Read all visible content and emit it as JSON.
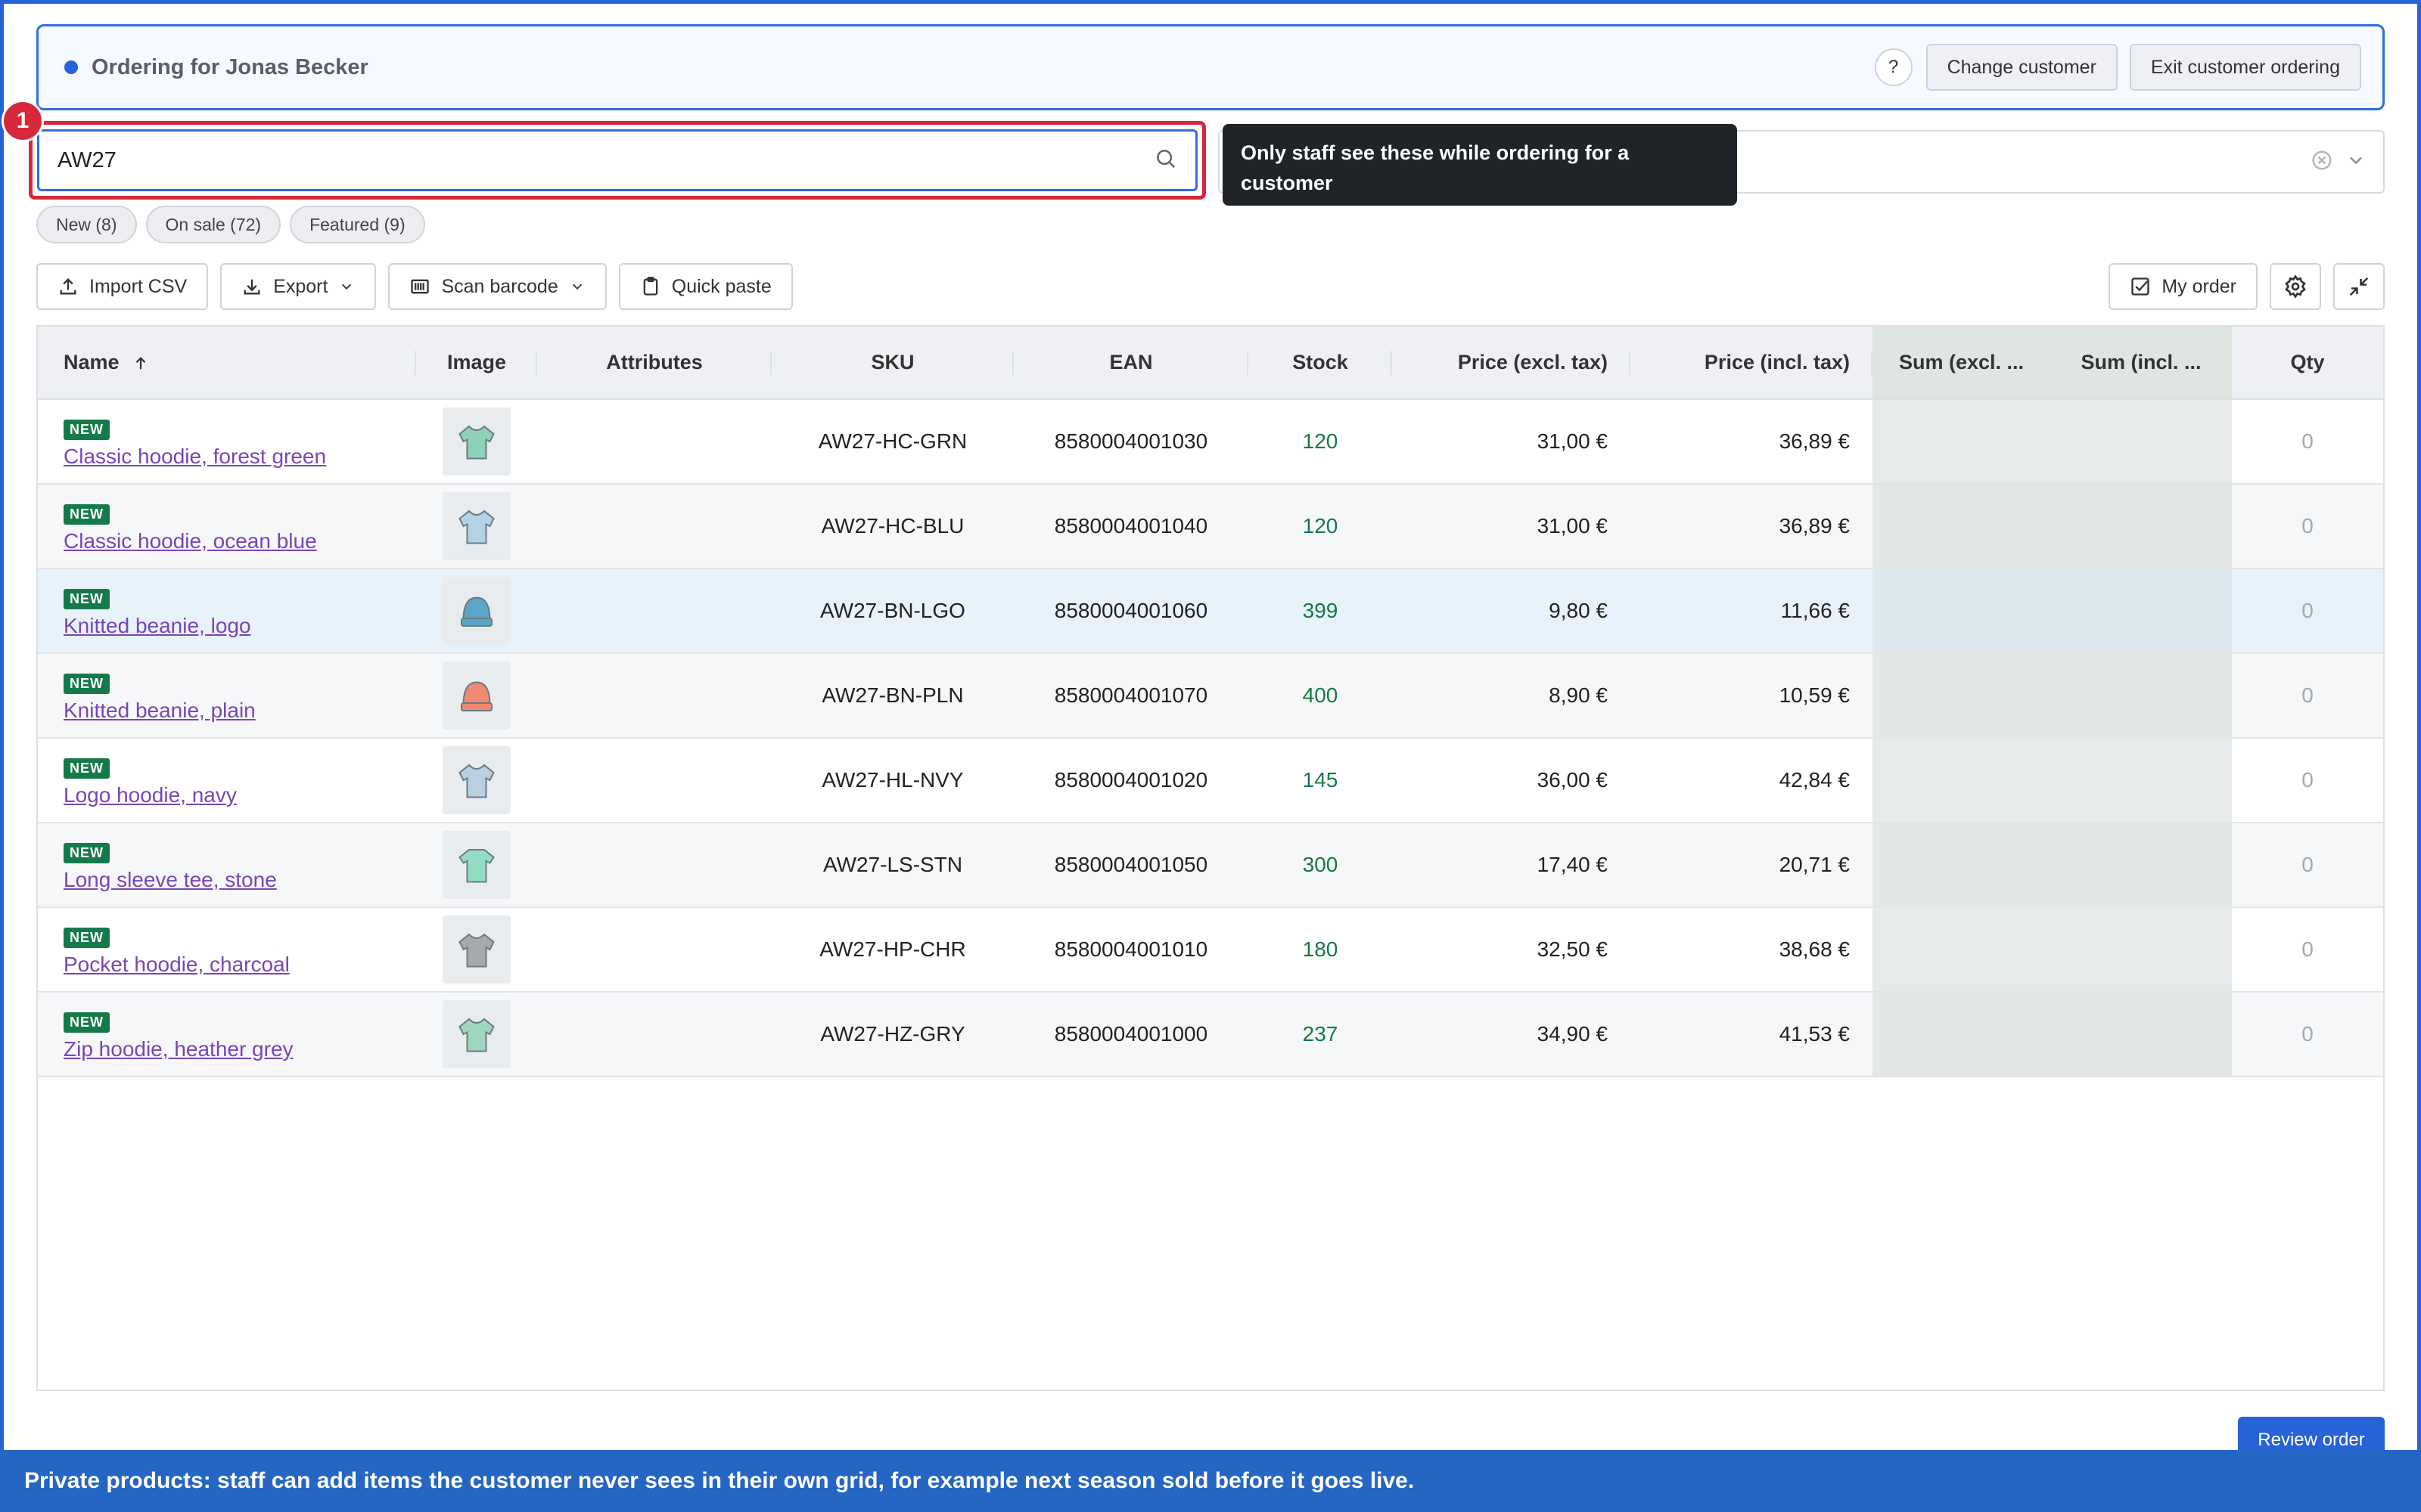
{
  "banner": {
    "title": "Ordering for Jonas Becker",
    "help_label": "?",
    "change_customer": "Change customer",
    "exit_ordering": "Exit customer ordering"
  },
  "search": {
    "value": "AW27",
    "step_number": "1"
  },
  "tooltip": {
    "text": "Only staff see these while ordering for a customer"
  },
  "chips": [
    "New (8)",
    "On sale (72)",
    "Featured (9)"
  ],
  "toolbar": {
    "import_csv": "Import CSV",
    "export": "Export",
    "scan_barcode": "Scan barcode",
    "quick_paste": "Quick paste",
    "my_order": "My order"
  },
  "table": {
    "columns": [
      "Name",
      "Image",
      "Attributes",
      "SKU",
      "EAN",
      "Stock",
      "Price (excl. tax)",
      "Price (incl. tax)",
      "Sum (excl. ...",
      "Sum (incl. ...",
      "Qty"
    ],
    "new_tag": "NEW",
    "rows": [
      {
        "name": "Classic hoodie, forest green",
        "sku": "AW27-HC-GRN",
        "ean": "8580004001030",
        "stock": "120",
        "price_ex": "31,00 €",
        "price_in": "36,89 €",
        "qty": "0",
        "thumb_color": "#8fd1b8",
        "thumb_icon": "hoodie-icon"
      },
      {
        "name": "Classic hoodie, ocean blue",
        "sku": "AW27-HC-BLU",
        "ean": "8580004001040",
        "stock": "120",
        "price_ex": "31,00 €",
        "price_in": "36,89 €",
        "qty": "0",
        "thumb_color": "#b4d2e6",
        "thumb_icon": "hoodie-icon"
      },
      {
        "name": "Knitted beanie, logo",
        "sku": "AW27-BN-LGO",
        "ean": "8580004001060",
        "stock": "399",
        "price_ex": "9,80 €",
        "price_in": "11,66 €",
        "qty": "0",
        "thumb_color": "#5aa6c8",
        "thumb_icon": "beanie-icon"
      },
      {
        "name": "Knitted beanie, plain",
        "sku": "AW27-BN-PLN",
        "ean": "8580004001070",
        "stock": "400",
        "price_ex": "8,90 €",
        "price_in": "10,59 €",
        "qty": "0",
        "thumb_color": "#ee8a72",
        "thumb_icon": "beanie-icon"
      },
      {
        "name": "Logo hoodie, navy",
        "sku": "AW27-HL-NVY",
        "ean": "8580004001020",
        "stock": "145",
        "price_ex": "36,00 €",
        "price_in": "42,84 €",
        "qty": "0",
        "thumb_color": "#b9cfe2",
        "thumb_icon": "hoodie-icon"
      },
      {
        "name": "Long sleeve tee, stone",
        "sku": "AW27-LS-STN",
        "ean": "8580004001050",
        "stock": "300",
        "price_ex": "17,40 €",
        "price_in": "20,71 €",
        "qty": "0",
        "thumb_color": "#92dcc4",
        "thumb_icon": "tee-icon"
      },
      {
        "name": "Pocket hoodie, charcoal",
        "sku": "AW27-HP-CHR",
        "ean": "8580004001010",
        "stock": "180",
        "price_ex": "32,50 €",
        "price_in": "38,68 €",
        "qty": "0",
        "thumb_color": "#a7a9ab",
        "thumb_icon": "hoodie-icon"
      },
      {
        "name": "Zip hoodie, heather grey",
        "sku": "AW27-HZ-GRY",
        "ean": "8580004001000",
        "stock": "237",
        "price_ex": "34,90 €",
        "price_in": "41,53 €",
        "qty": "0",
        "thumb_color": "#9fd6c0",
        "thumb_icon": "hoodie-icon"
      }
    ]
  },
  "review_order": "Review order",
  "caption": "Private products: staff can add items the customer never sees in their own grid, for example next season sold before it goes live.",
  "colors": {
    "accent": "#2563d6",
    "highlight": "#d7283a",
    "stock": "#137a45",
    "link": "#7a45b5"
  }
}
